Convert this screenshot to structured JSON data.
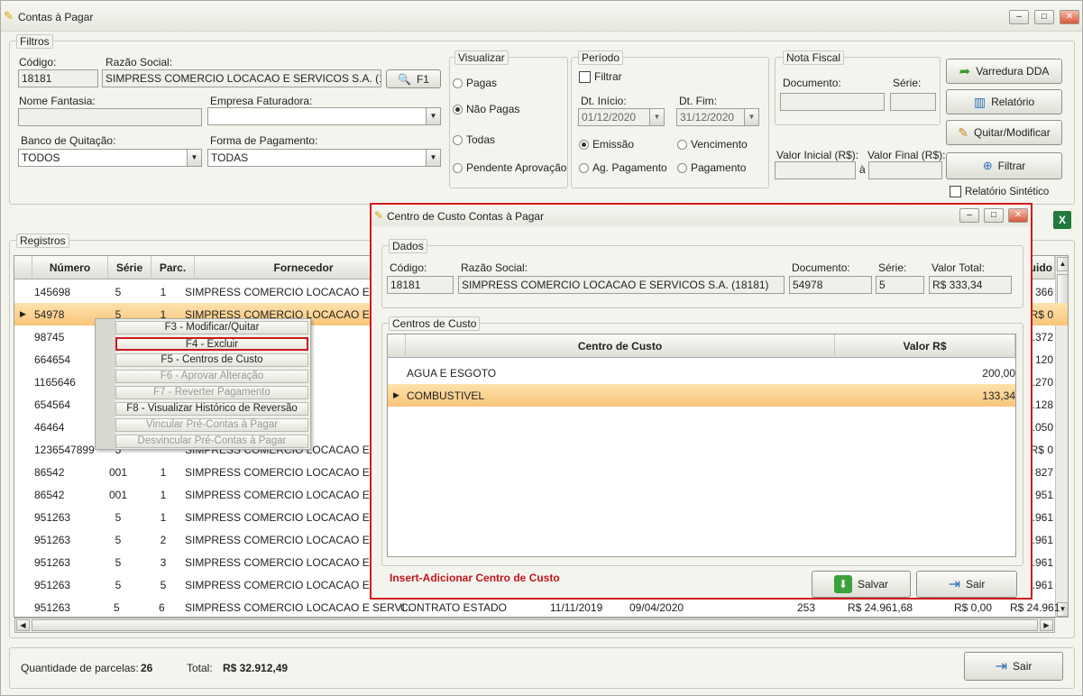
{
  "window": {
    "title": "Contas à Pagar"
  },
  "filtros": {
    "legend": "Filtros",
    "codigo_label": "Código:",
    "codigo_value": "18181",
    "razao_label": "Razão Social:",
    "razao_value": "SIMPRESS COMERCIO LOCACAO E SERVICOS S.A. (18181)",
    "f1_label": "F1",
    "nome_fantasia_label": "Nome Fantasia:",
    "nome_fantasia_value": "",
    "empresa_label": "Empresa Faturadora:",
    "empresa_value": "",
    "banco_label": "Banco de Quitação:",
    "banco_value": "TODOS",
    "forma_label": "Forma de Pagamento:",
    "forma_value": "TODAS"
  },
  "visualizar": {
    "legend": "Visualizar",
    "options": [
      "Pagas",
      "Não Pagas",
      "Todas",
      "Pendente Aprovação"
    ],
    "selected": "Não Pagas"
  },
  "periodo": {
    "legend": "Período",
    "filtrar_label": "Filtrar",
    "filtrar_checked": false,
    "inicio_label": "Dt. Início:",
    "inicio_value": "01/12/2020",
    "fim_label": "Dt. Fim:",
    "fim_value": "31/12/2020",
    "opts": [
      "Emissão",
      "Vencimento",
      "Ag. Pagamento",
      "Pagamento"
    ],
    "selected": "Emissão"
  },
  "nota": {
    "legend": "Nota Fiscal",
    "documento_label": "Documento:",
    "serie_label": "Série:",
    "valor_inicial_label": "Valor Inicial (R$):",
    "valor_final_label": "Valor Final (R$):",
    "a_label": "à"
  },
  "actions": {
    "varredura": "Varredura DDA",
    "relatorio": "Relatório",
    "quitar": "Quitar/Modificar",
    "filtrar": "Filtrar",
    "sintetico": "Relatório Sintético"
  },
  "registros": {
    "legend": "Registros",
    "columns": [
      "Número",
      "Série",
      "Parc.",
      "Fornecedor"
    ],
    "right_header": "uido",
    "rows": [
      {
        "numero": "145698",
        "serie": "5",
        "parc": "1",
        "fornecedor": "SIMPRESS COMERCIO LOCACAO E S",
        "right": "R$ 366"
      },
      {
        "numero": "54978",
        "serie": "5",
        "parc": "1",
        "fornecedor": "SIMPRESS COMERCIO LOCACAO E S",
        "right": "R$ 0"
      },
      {
        "numero": "98745",
        "serie": "",
        "parc": "",
        "fornecedor": "CACAO E S",
        "right": ".372"
      },
      {
        "numero": "664654",
        "serie": "",
        "parc": "",
        "fornecedor": "CACAO E S",
        "right": "120"
      },
      {
        "numero": "1165646",
        "serie": "",
        "parc": "",
        "fornecedor": "CACAO E S",
        "right": ".270"
      },
      {
        "numero": "654564",
        "serie": "",
        "parc": "",
        "fornecedor": "CACAO E S",
        "right": "2.128"
      },
      {
        "numero": "46464",
        "serie": "",
        "parc": "",
        "fornecedor": "CACAO E S",
        "right": ".050"
      },
      {
        "numero": "1236547899",
        "serie": "5",
        "parc": "",
        "fornecedor": "SIMPRESS COMERCIO LOCACAO E S",
        "right": "R$ 0"
      },
      {
        "numero": "86542",
        "serie": "001",
        "parc": "1",
        "fornecedor": "SIMPRESS COMERCIO LOCACAO E S",
        "right": "827"
      },
      {
        "numero": "86542",
        "serie": "001",
        "parc": "1",
        "fornecedor": "SIMPRESS COMERCIO LOCACAO E S",
        "right": "951"
      },
      {
        "numero": "951263",
        "serie": "5",
        "parc": "1",
        "fornecedor": "SIMPRESS COMERCIO LOCACAO E S",
        "right": ".961"
      },
      {
        "numero": "951263",
        "serie": "5",
        "parc": "2",
        "fornecedor": "SIMPRESS COMERCIO LOCACAO E S",
        "right": ".961"
      },
      {
        "numero": "951263",
        "serie": "5",
        "parc": "3",
        "fornecedor": "SIMPRESS COMERCIO LOCACAO E S",
        "right": ".961"
      },
      {
        "numero": "951263",
        "serie": "5",
        "parc": "5",
        "fornecedor": "SIMPRESS COMERCIO LOCACAO E S",
        "right": ".961"
      }
    ],
    "last_row": {
      "numero": "951263",
      "serie": "5",
      "parc": "6",
      "fornecedor": "SIMPRESS COMERCIO LOCACAO E SERVI...",
      "contrato": "CONTRATO ESTADO",
      "data1": "11/11/2019",
      "data2": "09/04/2020",
      "num": "253",
      "v1": "R$ 24.961,68",
      "v2": "R$ 0,00",
      "v3": "R$ 24.961"
    }
  },
  "context_menu": [
    {
      "label": "F3 - Modificar/Quitar",
      "enabled": true
    },
    {
      "label": "F4 - Excluir",
      "enabled": true,
      "highlight": true
    },
    {
      "label": "F5 - Centros de Custo",
      "enabled": true
    },
    {
      "label": "F6 - Aprovar Alteração",
      "enabled": false
    },
    {
      "label": "F7 - Reverter Pagamento",
      "enabled": false
    },
    {
      "label": "F8 - Visualizar Histórico de Reversão",
      "enabled": true
    },
    {
      "label": "Vincular Pré-Contas à Pagar",
      "enabled": false
    },
    {
      "label": "Desvincular Pré-Contas à Pagar",
      "enabled": false
    }
  ],
  "dialog": {
    "title": "Centro de Custo Contas à Pagar",
    "dados_legend": "Dados",
    "codigo_label": "Código:",
    "codigo_value": "18181",
    "razao_label": "Razão Social:",
    "razao_value": "SIMPRESS COMERCIO LOCACAO E SERVICOS S.A. (18181)",
    "documento_label": "Documento:",
    "documento_value": "54978",
    "serie_label": "Série:",
    "serie_value": "5",
    "valor_label": "Valor Total:",
    "valor_value": "R$ 333,34",
    "centros_legend": "Centros de Custo",
    "col_centro": "Centro de Custo",
    "col_valor": "Valor R$",
    "rows": [
      {
        "centro": "AGUA E ESGOTO",
        "valor": "200,00"
      },
      {
        "centro": "COMBUSTIVEL",
        "valor": "133,34"
      }
    ],
    "hint": "Insert-Adicionar Centro de Custo",
    "salvar": "Salvar",
    "sair": "Sair"
  },
  "footer": {
    "qtd_label": "Quantidade de parcelas:",
    "qtd_value": "26",
    "total_label": "Total:",
    "total_value": "R$ 32.912,49",
    "sair": "Sair"
  }
}
